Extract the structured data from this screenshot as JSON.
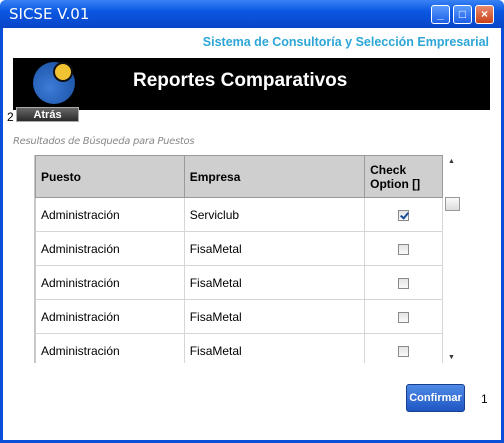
{
  "window": {
    "title": "SICSE V.01",
    "minimize_glyph": "_",
    "maximize_glyph": "□",
    "close_glyph": "×"
  },
  "header": {
    "subtitle": "Sistema de Consultoría y Selección Empresarial",
    "banner_title": "Reportes Comparativos",
    "back_label": "Atrás",
    "side_number": "2"
  },
  "results": {
    "label": "Resultados de Búsqueda para Puestos",
    "columns": [
      "Puesto",
      "Empresa",
      "Check Option []"
    ],
    "rows": [
      {
        "puesto": "Administración",
        "empresa": "Serviclub",
        "checked": true
      },
      {
        "puesto": "Administración",
        "empresa": "FisaMetal",
        "checked": false
      },
      {
        "puesto": "Administración",
        "empresa": "FisaMetal",
        "checked": false
      },
      {
        "puesto": "Administración",
        "empresa": "FisaMetal",
        "checked": false
      },
      {
        "puesto": "Administración",
        "empresa": "FisaMetal",
        "checked": false
      }
    ]
  },
  "footer": {
    "confirm_label": "Confirmar",
    "count": "1"
  },
  "colors": {
    "accent": "#2ca6d6",
    "titlebar": "#0a57e2",
    "button": "#1f56c4"
  }
}
